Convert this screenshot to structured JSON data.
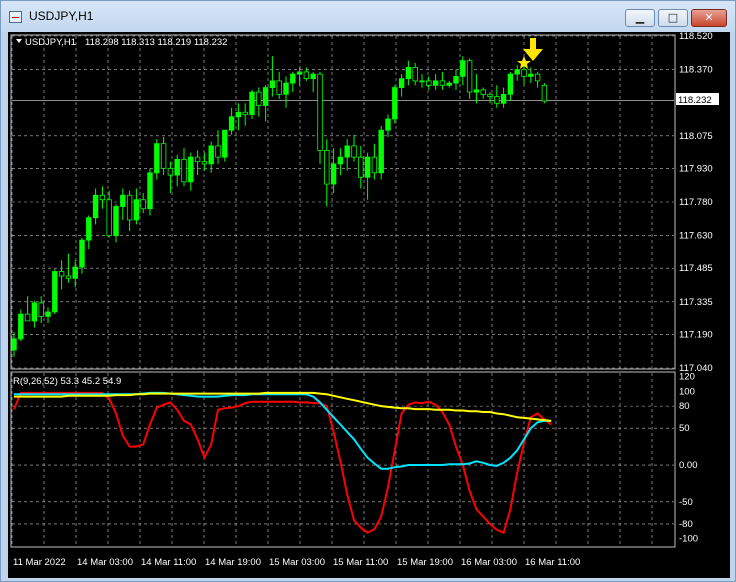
{
  "window": {
    "title": "USDJPY,H1",
    "controls": {
      "minimize": "▁",
      "maximize": "□",
      "close": "✕"
    }
  },
  "chart_data": [
    {
      "type": "candlestick",
      "title": "USDJPY,H1",
      "header_values": "118.298 118.313 118.219 118.232",
      "current_price": "118.232",
      "colors": {
        "background": "#000000",
        "bull": "#00ff00",
        "bear": "#000000",
        "wick": "#00ff00",
        "grid": "#c0c0c0",
        "marker": "#ffe600",
        "axis_text": "#ffffff"
      },
      "y_ticks": [
        "118.520",
        "118.370",
        "118.232",
        "118.075",
        "117.930",
        "117.780",
        "117.630",
        "117.485",
        "117.335",
        "117.190",
        "117.040"
      ],
      "ylim": [
        117.04,
        118.52
      ],
      "x_ticks": [
        "11 Mar 2022",
        "14 Mar 03:00",
        "14 Mar 11:00",
        "14 Mar 19:00",
        "15 Mar 03:00",
        "15 Mar 11:00",
        "15 Mar 19:00",
        "16 Mar 03:00",
        "16 Mar 11:00"
      ],
      "grid": true,
      "markers": {
        "arrow": "down-arrow-icon",
        "star": "star-icon"
      },
      "candles": [
        [
          117.12,
          117.2,
          117.09,
          117.17
        ],
        [
          117.17,
          117.3,
          117.16,
          117.28
        ],
        [
          117.28,
          117.36,
          117.25,
          117.25
        ],
        [
          117.25,
          117.34,
          117.22,
          117.33
        ],
        [
          117.33,
          117.36,
          117.24,
          117.27
        ],
        [
          117.27,
          117.31,
          117.24,
          117.29
        ],
        [
          117.29,
          117.48,
          117.28,
          117.47
        ],
        [
          117.47,
          117.52,
          117.39,
          117.45
        ],
        [
          117.45,
          117.55,
          117.42,
          117.44
        ],
        [
          117.44,
          117.52,
          117.4,
          117.49
        ],
        [
          117.49,
          117.62,
          117.46,
          117.61
        ],
        [
          117.61,
          117.72,
          117.57,
          117.71
        ],
        [
          117.71,
          117.84,
          117.68,
          117.81
        ],
        [
          117.81,
          117.85,
          117.75,
          117.79
        ],
        [
          117.79,
          117.83,
          117.62,
          117.63
        ],
        [
          117.63,
          117.77,
          117.6,
          117.76
        ],
        [
          117.76,
          117.84,
          117.7,
          117.81
        ],
        [
          117.81,
          117.83,
          117.65,
          117.7
        ],
        [
          117.7,
          117.84,
          117.68,
          117.79
        ],
        [
          117.79,
          117.82,
          117.73,
          117.75
        ],
        [
          117.75,
          117.93,
          117.72,
          117.91
        ],
        [
          117.91,
          118.06,
          117.88,
          118.04
        ],
        [
          118.04,
          118.07,
          117.9,
          117.93
        ],
        [
          117.93,
          117.96,
          117.82,
          117.9
        ],
        [
          117.9,
          117.99,
          117.85,
          117.97
        ],
        [
          117.97,
          118.02,
          117.85,
          117.87
        ],
        [
          117.87,
          118.0,
          117.83,
          117.98
        ],
        [
          117.98,
          118.01,
          117.9,
          117.96
        ],
        [
          117.96,
          118.0,
          117.92,
          117.95
        ],
        [
          117.95,
          118.05,
          117.91,
          118.03
        ],
        [
          118.03,
          118.1,
          117.95,
          117.98
        ],
        [
          117.98,
          118.1,
          117.96,
          118.1
        ],
        [
          118.1,
          118.2,
          118.08,
          118.16
        ],
        [
          118.16,
          118.22,
          118.1,
          118.18
        ],
        [
          118.18,
          118.22,
          118.12,
          118.17
        ],
        [
          118.17,
          118.28,
          118.15,
          118.27
        ],
        [
          118.27,
          118.29,
          118.16,
          118.21
        ],
        [
          118.21,
          118.3,
          118.14,
          118.29
        ],
        [
          118.29,
          118.43,
          118.25,
          118.32
        ],
        [
          118.32,
          118.36,
          118.24,
          118.26
        ],
        [
          118.26,
          118.34,
          118.2,
          118.31
        ],
        [
          118.31,
          118.36,
          118.27,
          118.35
        ],
        [
          118.35,
          118.38,
          118.3,
          118.36
        ],
        [
          118.36,
          118.38,
          118.32,
          118.33
        ],
        [
          118.33,
          118.36,
          118.27,
          118.35
        ],
        [
          118.35,
          118.36,
          117.95,
          118.01
        ],
        [
          118.01,
          118.06,
          117.76,
          117.86
        ],
        [
          117.86,
          118.02,
          117.82,
          117.95
        ],
        [
          117.95,
          118.02,
          117.9,
          117.98
        ],
        [
          117.98,
          118.06,
          117.92,
          118.03
        ],
        [
          118.03,
          118.08,
          117.96,
          117.98
        ],
        [
          117.98,
          118.03,
          117.84,
          117.89
        ],
        [
          117.89,
          118.0,
          117.79,
          117.98
        ],
        [
          117.98,
          118.04,
          117.88,
          117.91
        ],
        [
          117.91,
          118.12,
          117.88,
          118.1
        ],
        [
          118.1,
          118.17,
          118.07,
          118.15
        ],
        [
          118.15,
          118.3,
          118.13,
          118.29
        ],
        [
          118.29,
          118.35,
          118.25,
          118.33
        ],
        [
          118.33,
          118.41,
          118.3,
          118.38
        ],
        [
          118.38,
          118.4,
          118.3,
          118.32
        ],
        [
          118.32,
          118.35,
          118.29,
          118.32
        ],
        [
          118.32,
          118.34,
          118.28,
          118.3
        ],
        [
          118.3,
          118.35,
          118.28,
          118.32
        ],
        [
          118.32,
          118.36,
          118.28,
          118.3
        ],
        [
          118.3,
          118.32,
          118.29,
          118.31
        ],
        [
          118.31,
          118.37,
          118.28,
          118.34
        ],
        [
          118.34,
          118.43,
          118.3,
          118.41
        ],
        [
          118.41,
          118.42,
          118.24,
          118.27
        ],
        [
          118.27,
          118.35,
          118.22,
          118.28
        ],
        [
          118.28,
          118.29,
          118.24,
          118.26
        ],
        [
          118.26,
          118.27,
          118.22,
          118.25
        ],
        [
          118.25,
          118.3,
          118.2,
          118.22
        ],
        [
          118.22,
          118.29,
          118.2,
          118.26
        ],
        [
          118.26,
          118.36,
          118.23,
          118.35
        ],
        [
          118.35,
          118.39,
          118.32,
          118.37
        ],
        [
          118.37,
          118.4,
          118.3,
          118.34
        ],
        [
          118.34,
          118.38,
          118.31,
          118.35
        ],
        [
          118.35,
          118.36,
          118.29,
          118.32
        ],
        [
          118.3,
          118.31,
          118.22,
          118.23
        ]
      ]
    },
    {
      "type": "line",
      "title": "R(9,26,52) 53.3 45.2 54.9",
      "ylim": [
        -110,
        125
      ],
      "y_ticks": [
        "120",
        "100",
        "80",
        "50",
        "0.00",
        "-50",
        "-80",
        "-100"
      ],
      "colors": {
        "fast": "#ff0000",
        "mid": "#00e5ff",
        "slow": "#ffff00"
      },
      "series": [
        {
          "color": "#ff0000",
          "values": [
            76,
            98,
            98,
            98,
            98,
            98,
            98,
            98,
            98,
            98,
            98,
            98,
            98,
            98,
            90,
            70,
            40,
            25,
            25,
            28,
            55,
            78,
            82,
            85,
            75,
            60,
            55,
            35,
            10,
            28,
            75,
            77,
            78,
            80,
            84,
            86,
            86,
            86,
            86,
            86,
            86,
            86,
            85,
            85,
            84,
            84,
            80,
            45,
            5,
            -40,
            -75,
            -85,
            -92,
            -87,
            -70,
            -30,
            20,
            70,
            82,
            85,
            84,
            86,
            82,
            72,
            55,
            25,
            0,
            -35,
            -60,
            -70,
            -80,
            -88,
            -92,
            -60,
            -10,
            30,
            65,
            70,
            62,
            55
          ]
        },
        {
          "color": "#00e5ff",
          "values": [
            96,
            96,
            96,
            96,
            96,
            96,
            96,
            96,
            96,
            96,
            96,
            96,
            96,
            96,
            96,
            96,
            96,
            96,
            96,
            97,
            98,
            98,
            98,
            97,
            96,
            95,
            94,
            93,
            93,
            93,
            93,
            94,
            95,
            95,
            95,
            96,
            96,
            96,
            96,
            96,
            96,
            96,
            96,
            96,
            93,
            85,
            75,
            65,
            55,
            45,
            35,
            22,
            10,
            2,
            -5,
            -5,
            -3,
            -2,
            0,
            0,
            0,
            0,
            0,
            0,
            1,
            1,
            1,
            2,
            5,
            3,
            0,
            -1,
            3,
            10,
            20,
            35,
            50,
            58,
            60,
            60
          ]
        },
        {
          "color": "#ffff00",
          "values": [
            93,
            93,
            93,
            93,
            93,
            93,
            93,
            93,
            94,
            94,
            94,
            94,
            94,
            94,
            94,
            95,
            95,
            95,
            96,
            96,
            97,
            97,
            97,
            97,
            97,
            97,
            97,
            97,
            97,
            97,
            97,
            97,
            97,
            97,
            97,
            97,
            97,
            98,
            98,
            98,
            98,
            98,
            98,
            98,
            98,
            97,
            96,
            94,
            92,
            90,
            88,
            86,
            84,
            82,
            80,
            79,
            78,
            77,
            77,
            76,
            76,
            76,
            75,
            75,
            75,
            74,
            74,
            73,
            73,
            72,
            72,
            70,
            69,
            67,
            65,
            64,
            63,
            62,
            61,
            60
          ]
        }
      ],
      "x_ticks": [
        "11 Mar 2022",
        "14 Mar 03:00",
        "14 Mar 11:00",
        "14 Mar 19:00",
        "15 Mar 03:00",
        "15 Mar 11:00",
        "15 Mar 19:00",
        "16 Mar 03:00",
        "16 Mar 11:00"
      ]
    }
  ]
}
